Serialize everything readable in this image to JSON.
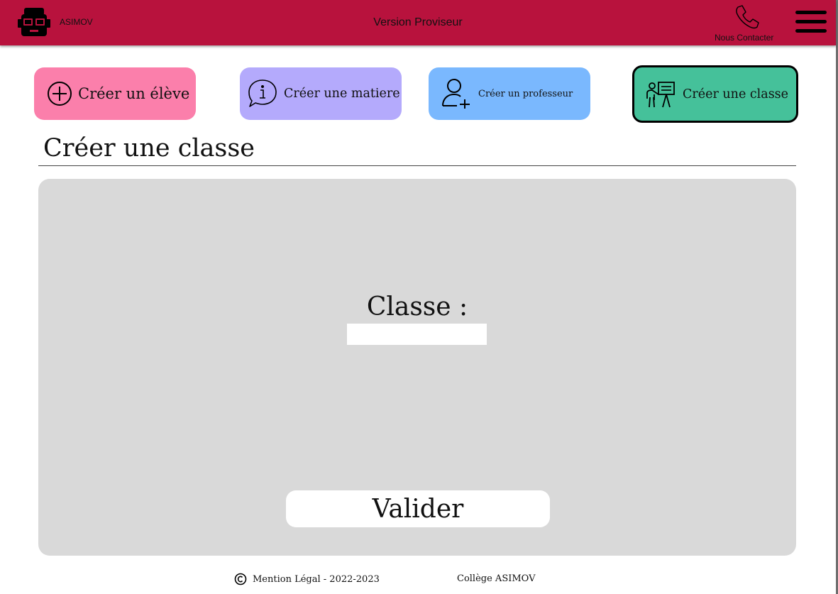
{
  "header": {
    "brand": "ASIMOV",
    "title": "Version Proviseur",
    "contact_label": "Nous Contacter",
    "logo_icon": "student-glasses-icon",
    "contact_icon": "phone-icon",
    "menu_icon": "hamburger-menu-icon",
    "background_color": "#b8123d"
  },
  "actions": [
    {
      "label": "Créer un élève",
      "icon": "plus-circle-icon",
      "color": "#fb7fab"
    },
    {
      "label": "Créer une matiere",
      "icon": "info-speech-bubble-icon",
      "color": "#b4aafc"
    },
    {
      "label": "Créer un professeur",
      "icon": "add-user-icon",
      "color": "#7ab8fe"
    },
    {
      "label": "Créer une classe",
      "icon": "teacher-board-icon",
      "color": "#45c19a",
      "active": true
    }
  ],
  "section": {
    "title": "Créer une classe"
  },
  "form": {
    "classe_label": "Classe :",
    "classe_value": "",
    "submit_label": "Valider",
    "panel_color": "#d9d9d9"
  },
  "footer": {
    "legal": "Mention Légal - 2022-2023",
    "college": "Collège ASIMOV",
    "copyright_icon": "copyright-icon"
  }
}
